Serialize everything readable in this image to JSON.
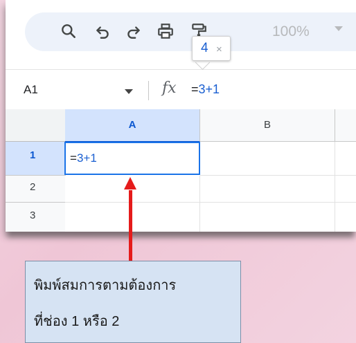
{
  "toolbar": {
    "icons": [
      "search-icon",
      "undo-icon",
      "redo-icon",
      "print-icon",
      "paint-format-icon"
    ],
    "zoom": "100%"
  },
  "tooltip": {
    "value": "4",
    "close": "×"
  },
  "formula_bar": {
    "cell_ref": "A1",
    "fx_label": "fx",
    "formula_eq": "=",
    "formula_expr": "3+1"
  },
  "grid": {
    "columns": [
      "A",
      "B"
    ],
    "rows": [
      "1",
      "2",
      "3"
    ],
    "cell_A1_eq": "=",
    "cell_A1_expr": "3+1"
  },
  "callout": {
    "line1": "พิมพ์สมการตามต้องการ",
    "line2": "ที่ช่อง 1 หรือ 2"
  },
  "colors": {
    "accent": "#1a73e8",
    "arrow": "#e51b1b",
    "callout_bg": "#d6e3f3",
    "background": "#efc6d6"
  }
}
